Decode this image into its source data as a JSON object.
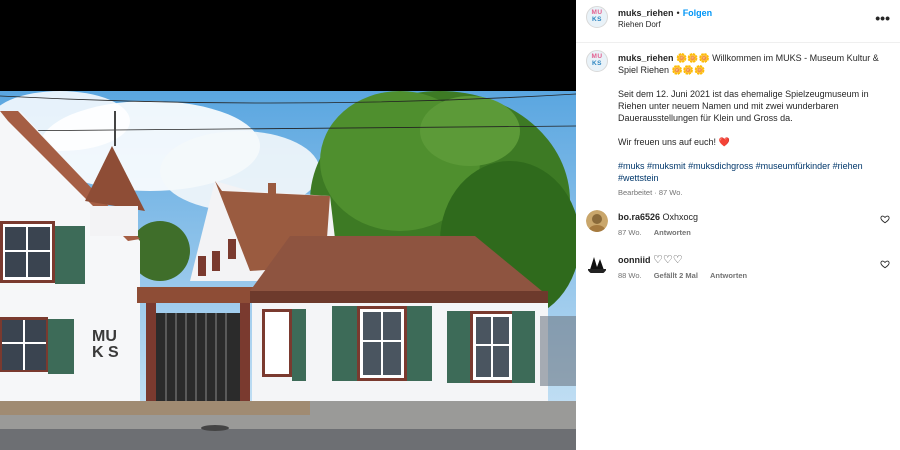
{
  "post": {
    "username": "muks_riehen",
    "separator": "•",
    "follow_label": "Folgen",
    "location": "Riehen Dorf",
    "more_icon": "more-dots-icon",
    "avatar_text_top": "MU",
    "avatar_text_bottom": "KS"
  },
  "image": {
    "building_sign_top": "MU",
    "building_sign_bottom_left": "K",
    "building_sign_bottom_right": "S"
  },
  "caption": {
    "username": "muks_riehen",
    "emoji_left": "🌼🌼🌼",
    "title": " Willkommen im MUKS - Museum Kultur & Spiel Riehen ",
    "emoji_right": "🌼🌼🌼",
    "paragraph": "Seit dem 12. Juni 2021 ist das ehemalige Spielzeugmuseum in Riehen unter neuem Namen und mit zwei wunderbaren Dauerausstellungen für Klein und Gross da.",
    "closing": "Wir freuen uns auf euch! ",
    "closing_heart": "❤️",
    "hashtags": [
      "#muks",
      "#muksmit",
      "#muksdichgross",
      "#museumfürkinder",
      "#riehen",
      "#wettstein"
    ],
    "edited": "Bearbeitet · 87 Wo."
  },
  "comments": [
    {
      "username": "bo.ra6526",
      "text": "Oxhxocg",
      "time": "87 Wo.",
      "likes": "",
      "reply_label": "Antworten"
    },
    {
      "username": "oonniid",
      "text": "♡♡♡",
      "time": "88 Wo.",
      "likes": "Gefällt 2 Mal",
      "reply_label": "Antworten"
    }
  ],
  "colors": {
    "follow": "#0095f6",
    "hashtag": "#00376b",
    "meta": "#737373",
    "heart_red": "#ed4956"
  }
}
